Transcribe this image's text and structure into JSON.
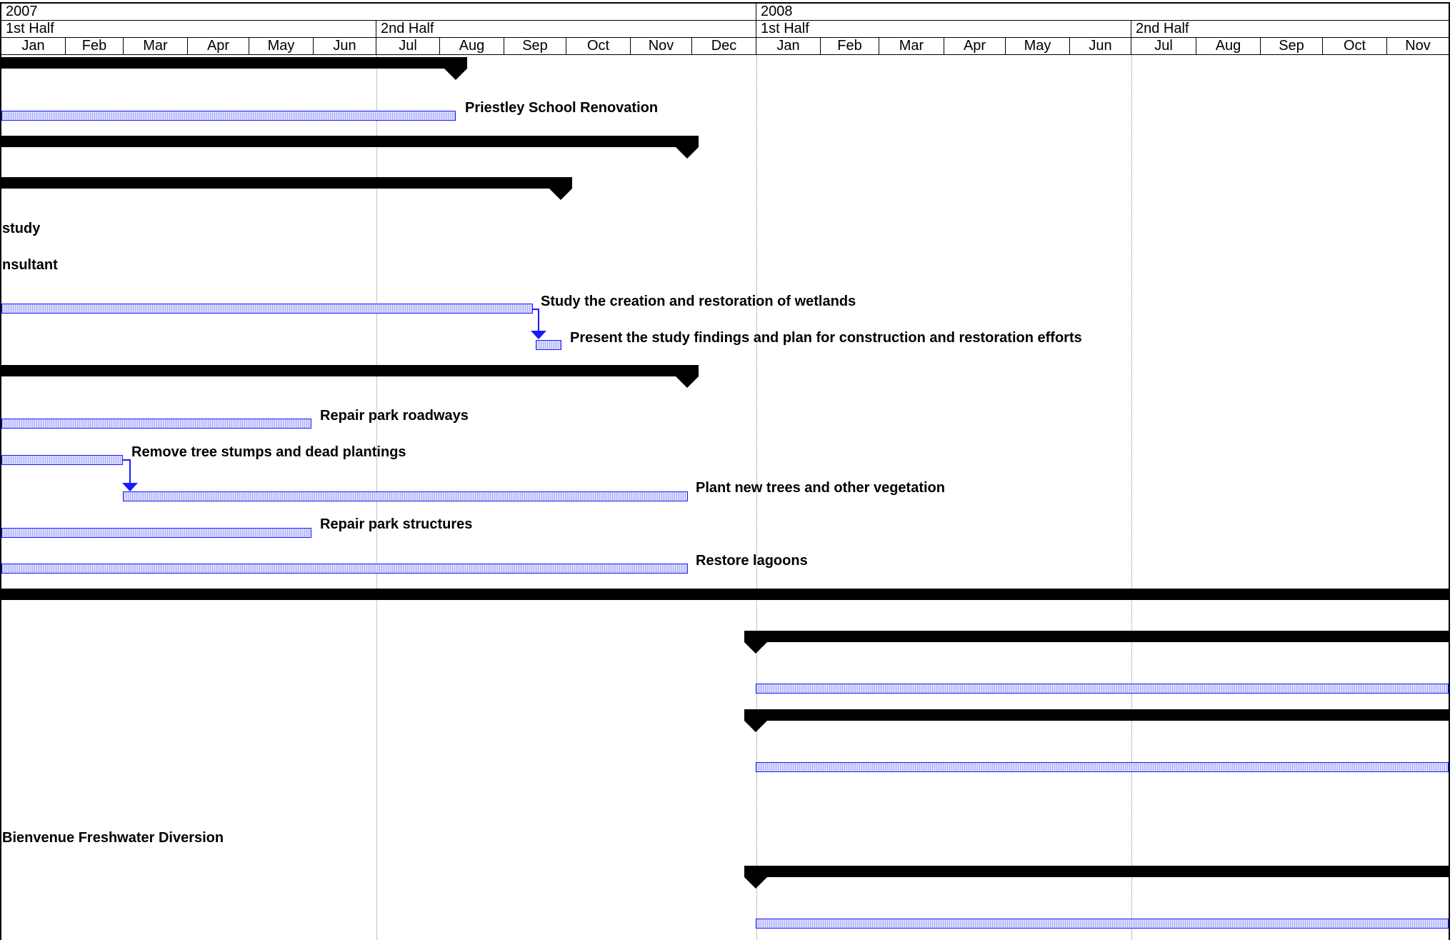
{
  "timescale": {
    "years": [
      "2007",
      "2008"
    ],
    "halves": [
      "1st Half",
      "2nd Half",
      "1st Half",
      "2nd Half"
    ],
    "months": [
      "Jan",
      "Feb",
      "Mar",
      "Apr",
      "May",
      "Jun",
      "Jul",
      "Aug",
      "Sep",
      "Oct",
      "Nov",
      "Dec",
      "Jan",
      "Feb",
      "Mar",
      "Apr",
      "May",
      "Jun",
      "Jul",
      "Aug",
      "Sep",
      "Oct",
      "Nov"
    ]
  },
  "colors": {
    "task_border": "#1a1aff",
    "task_fill": "#d9dcfb",
    "summary": "#000000",
    "dependency": "#1a1aff"
  },
  "rows": [
    {
      "kind": "summary",
      "start": "2007-01",
      "end": "2007-08-15",
      "label": ""
    },
    {
      "kind": "task",
      "start": "2007-01",
      "end": "2007-08-15",
      "label": "Priestley School Renovation"
    },
    {
      "kind": "summary",
      "start": "2007-01",
      "end": "2007-12-01",
      "label": ""
    },
    {
      "kind": "summary",
      "start": "2007-01",
      "end": "2007-09-20",
      "label": ""
    },
    {
      "kind": "text",
      "label": "study"
    },
    {
      "kind": "text",
      "label": "nsultant"
    },
    {
      "kind": "task",
      "start": "2007-01",
      "end": "2007-09-10",
      "label": "Study the creation and restoration of wetlands"
    },
    {
      "kind": "task",
      "start": "2007-09-10",
      "end": "2007-09-22",
      "label": "Present the study findings and plan for construction and restoration efforts"
    },
    {
      "kind": "summary",
      "start": "2007-01",
      "end": "2007-12-01",
      "label": ""
    },
    {
      "kind": "task",
      "start": "2007-01",
      "end": "2007-06-01",
      "label": "Repair park roadways"
    },
    {
      "kind": "task",
      "start": "2007-01",
      "end": "2007-03-01",
      "label": "Remove tree stumps and dead plantings"
    },
    {
      "kind": "task",
      "start": "2007-03-01",
      "end": "2007-12-01",
      "label": "Plant new trees and other vegetation"
    },
    {
      "kind": "task",
      "start": "2007-01",
      "end": "2007-06-01",
      "label": "Repair park structures"
    },
    {
      "kind": "task",
      "start": "2007-01",
      "end": "2007-12-01",
      "label": "Restore lagoons"
    },
    {
      "kind": "summary",
      "start": "2007-01",
      "end": "2008-12",
      "label": ""
    },
    {
      "kind": "summary",
      "start": "2008-01",
      "end": "2008-12",
      "label": ""
    },
    {
      "kind": "task",
      "start": "2008-01",
      "end": "2008-12",
      "label": ""
    },
    {
      "kind": "summary",
      "start": "2008-01",
      "end": "2008-12",
      "label": ""
    },
    {
      "kind": "task",
      "start": "2008-01",
      "end": "2008-12",
      "label": ""
    },
    {
      "kind": "text",
      "label": "Bienvenue Freshwater Diversion"
    },
    {
      "kind": "summary",
      "start": "2008-01",
      "end": "2008-12",
      "label": ""
    },
    {
      "kind": "task",
      "start": "2008-01",
      "end": "2008-12",
      "label": ""
    }
  ],
  "dependencies": [
    {
      "from": "Study the creation and restoration of wetlands",
      "to": "Present the study findings and plan for construction and restoration efforts"
    },
    {
      "from": "Remove tree stumps and dead plantings",
      "to": "Plant new trees and other vegetation"
    }
  ]
}
